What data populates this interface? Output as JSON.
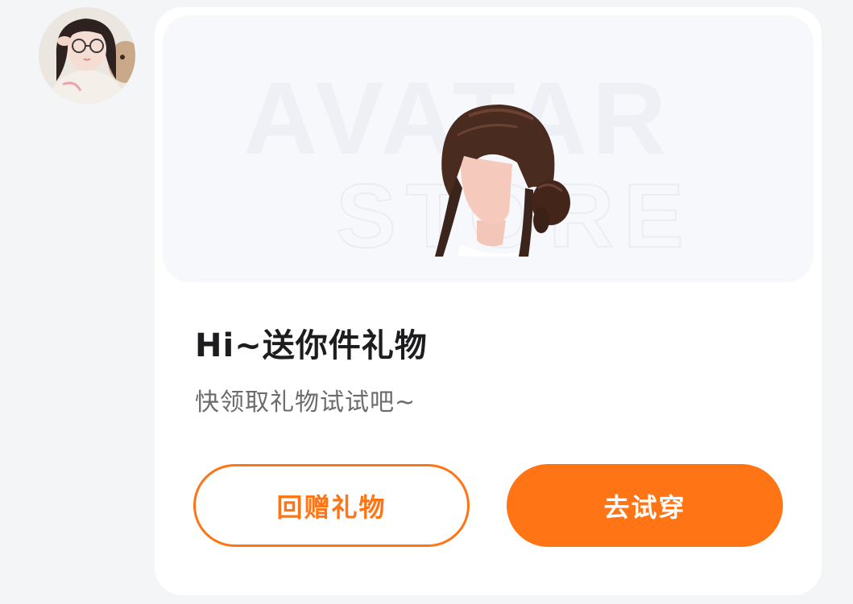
{
  "avatar": {
    "alt": "user-avatar"
  },
  "preview": {
    "watermark_top": "AVATAR",
    "watermark_bottom": "STORE"
  },
  "message": {
    "title": "Hi~送你件礼物",
    "subtitle": "快领取礼物试试吧~"
  },
  "actions": {
    "return_gift_label": "回赠礼物",
    "try_on_label": "去试穿"
  },
  "colors": {
    "accent": "#ff7415",
    "card_bg": "#ffffff",
    "page_bg": "#f4f5f7",
    "preview_bg": "#f7f8fc"
  }
}
